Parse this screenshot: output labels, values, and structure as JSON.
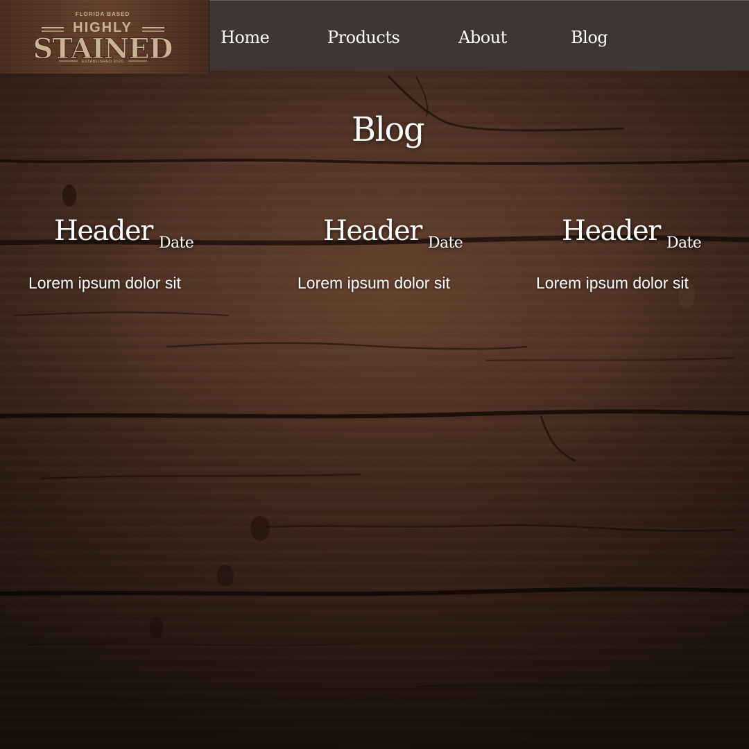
{
  "logo": {
    "top_text": "FLORIDA BASED",
    "line1": "HIGHLY",
    "line2": "STAINED",
    "bottom_text": "ESTABLISHED 2020"
  },
  "nav": {
    "items": [
      {
        "label": "Home"
      },
      {
        "label": "Products"
      },
      {
        "label": "About"
      },
      {
        "label": "Blog"
      }
    ]
  },
  "page": {
    "title": "Blog"
  },
  "posts": [
    {
      "header": "Header",
      "date": "Date",
      "body": "Lorem ipsum dolor sit"
    },
    {
      "header": "Header",
      "date": "Date",
      "body": "Lorem ipsum dolor sit"
    },
    {
      "header": "Header",
      "date": "Date",
      "body": "Lorem ipsum dolor sit"
    }
  ],
  "colors": {
    "nav_background": "#3f3533",
    "wood_dark": "#2a1911",
    "wood_mid": "#4a2e22",
    "text": "#ffffff",
    "logo_text": "#c9b295"
  }
}
